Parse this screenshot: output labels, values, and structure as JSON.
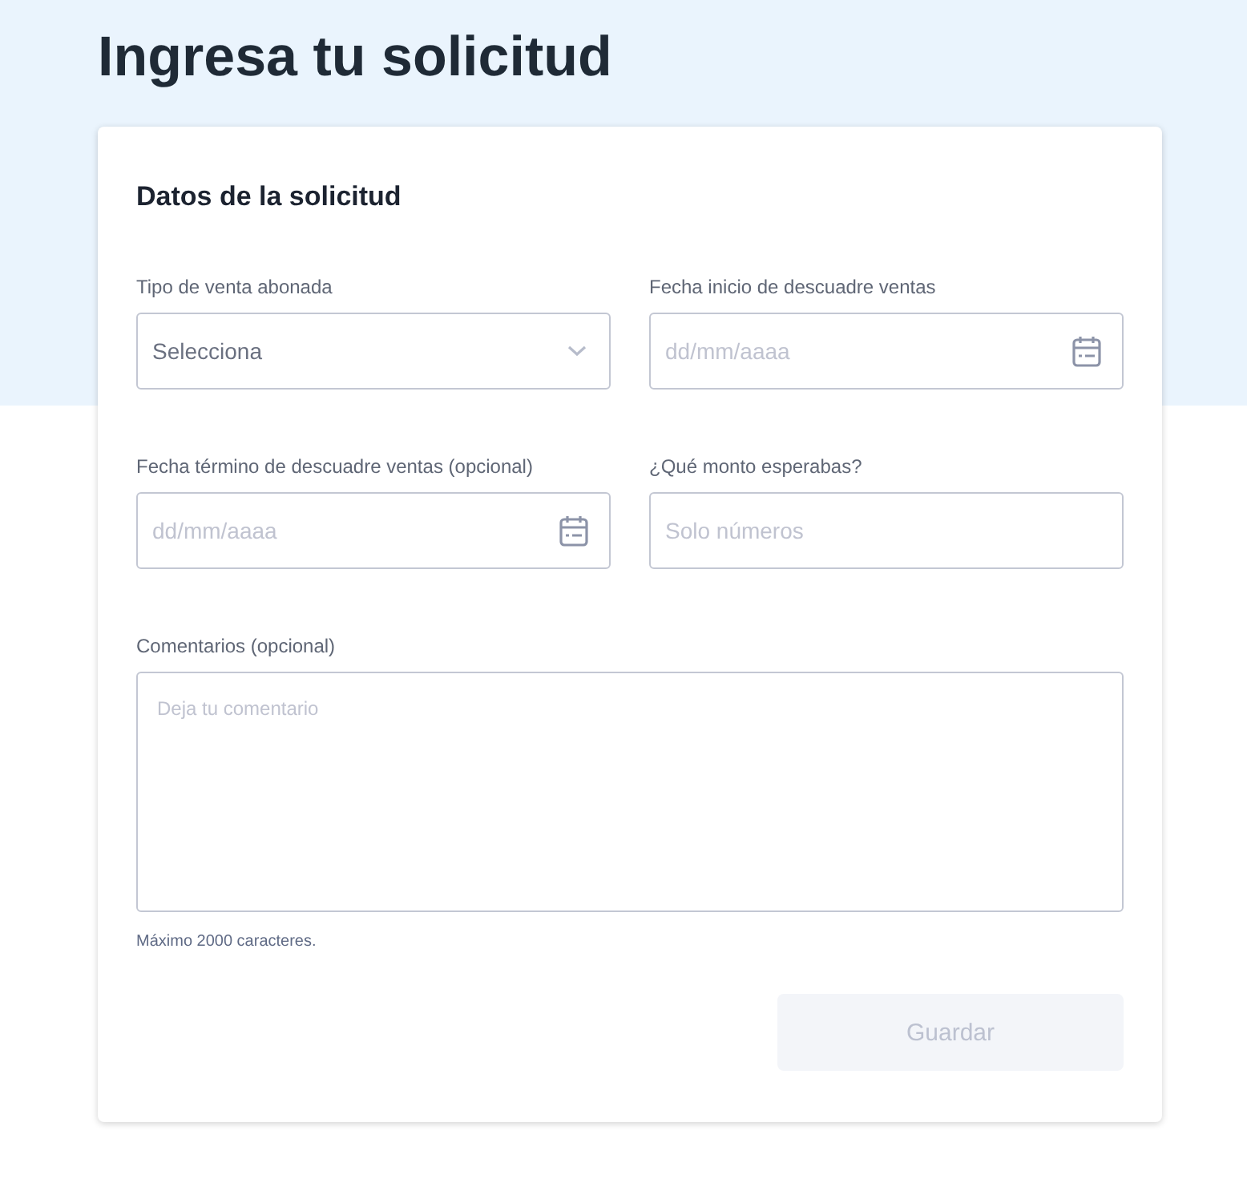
{
  "page_title": "Ingresa tu solicitud",
  "card": {
    "title": "Datos de la solicitud",
    "fields": [
      {
        "kind": "select",
        "label": "Tipo de venta abonada",
        "value": "Selecciona"
      },
      {
        "kind": "date",
        "label": "Fecha inicio de descuadre ventas",
        "placeholder": "dd/mm/aaaa"
      },
      {
        "kind": "date",
        "label": "Fecha término de descuadre ventas (opcional)",
        "placeholder": "dd/mm/aaaa"
      },
      {
        "kind": "text",
        "label": "¿Qué monto esperabas?",
        "placeholder": "Solo números"
      }
    ],
    "comment": {
      "label": "Comentarios (opcional)",
      "placeholder": "Deja tu comentario",
      "hint": "Máximo 2000 caracteres."
    },
    "save_button": {
      "label": "Guardar",
      "disabled": true
    }
  }
}
